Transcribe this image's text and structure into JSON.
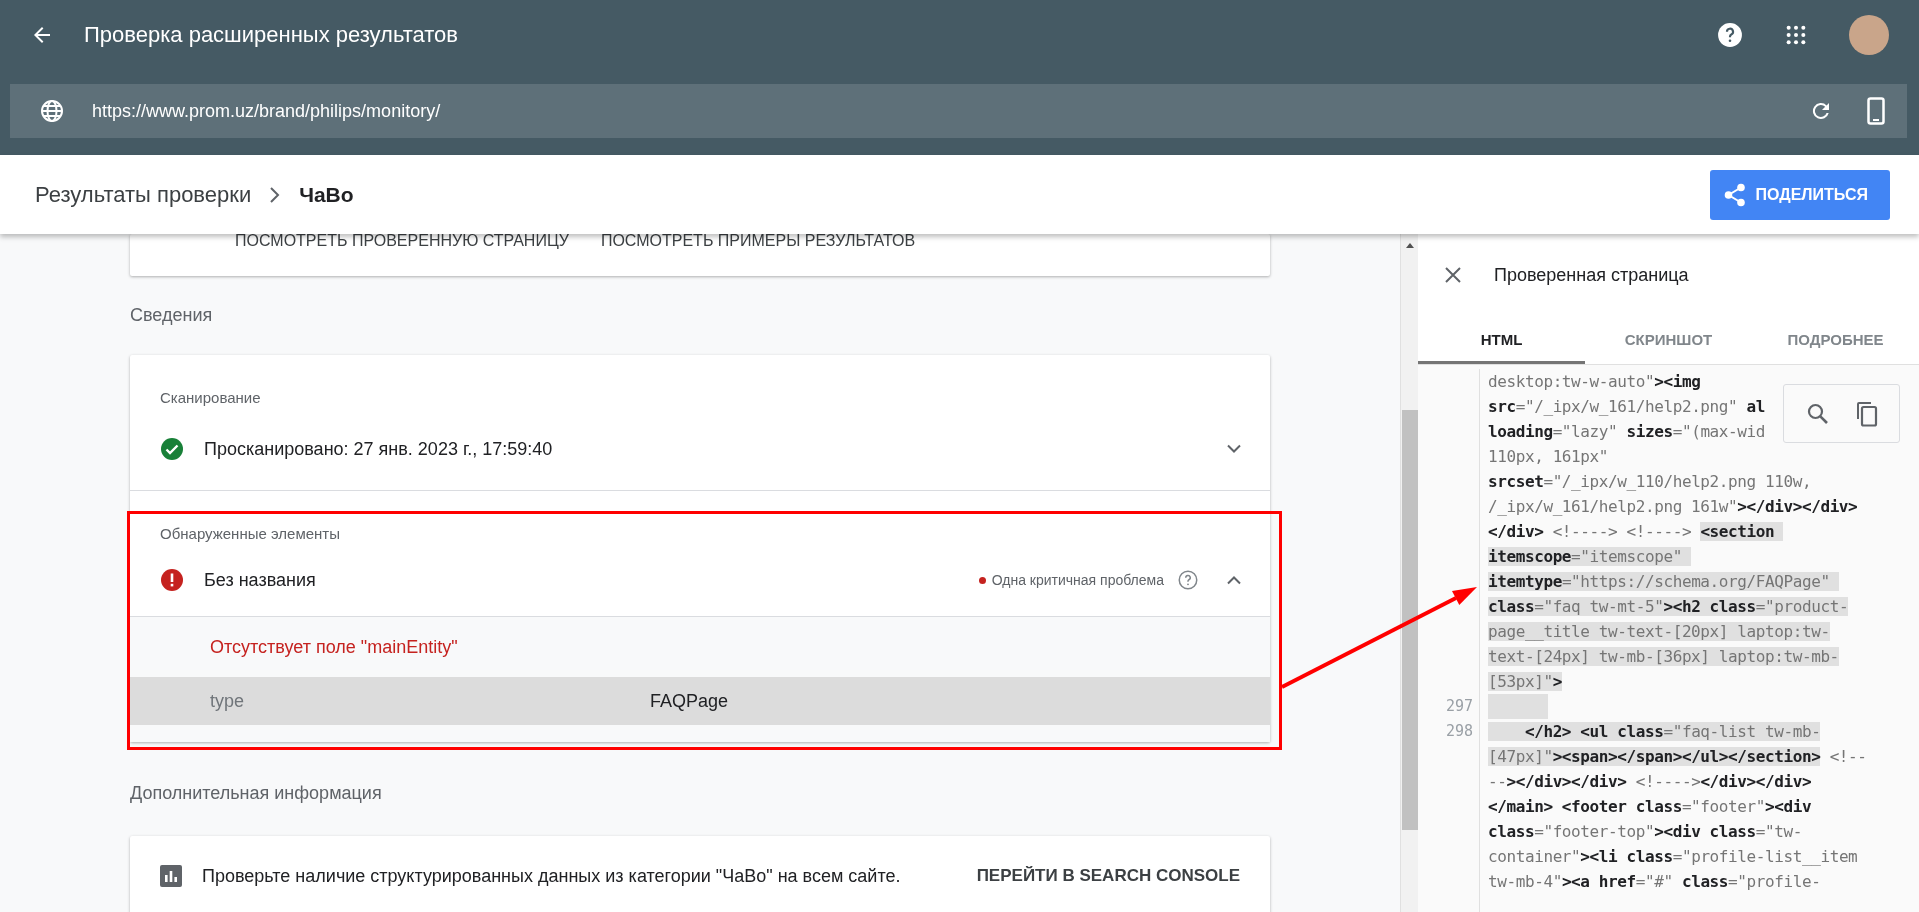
{
  "app_bar": {
    "title": "Проверка расширенных результатов"
  },
  "url_bar": {
    "value": "https://www.prom.uz/brand/philips/monitory/"
  },
  "breadcrumb": [
    {
      "label": "Результаты проверки"
    },
    {
      "label": "ЧаВо"
    }
  ],
  "share_button": "ПОДЕЛИТЬСЯ",
  "top_card": {
    "links": [
      "ПОСМОТРЕТЬ ПРОВЕРЕННУЮ СТРАНИЦУ",
      "ПОСМОТРЕТЬ ПРИМЕРЫ РЕЗУЛЬТАТОВ"
    ]
  },
  "details": {
    "heading": "Сведения",
    "sections": [
      {
        "label": "Сканирование",
        "highlighted": false,
        "items": [
          {
            "kind": "ok",
            "title": "Просканировано: 27 янв. 2023 г., 17:59:40",
            "expanded": false
          }
        ]
      },
      {
        "label": "Обнаруженные элементы",
        "highlighted": true,
        "items": [
          {
            "kind": "error",
            "title": "Без названия",
            "issue_count": "Одна критичная проблема",
            "expanded": true,
            "error": "Отсутствует поле \"mainEntity\"",
            "properties": [
              {
                "name": "type",
                "value": "FAQPage"
              }
            ]
          }
        ]
      }
    ]
  },
  "more_info": {
    "heading": "Дополнительная информация",
    "text": "Проверьте наличие структурированных данных из категории \"ЧаВо\" на всем сайте.",
    "link": "ПЕРЕЙТИ В SEARCH CONSOLE"
  },
  "panel": {
    "title": "Проверенная страница",
    "tabs": [
      {
        "label": "HTML",
        "selected": true
      },
      {
        "label": "СКРИНШОТ",
        "selected": false
      },
      {
        "label": "ПОДРОБНЕЕ",
        "selected": false
      }
    ],
    "code_lines": [
      {
        "segments": [
          {
            "text": "desktop:tw-w-auto\"**><img**",
            "highlighted": false
          }
        ]
      },
      {
        "segments": [
          {
            "text": "**src**=\"/_ipx/w_161/help2.png\" **al**",
            "highlighted": false
          }
        ]
      },
      {
        "segments": [
          {
            "text": "**loading**=\"lazy\" **sizes**=\"(max-wid",
            "highlighted": false
          }
        ]
      },
      {
        "segments": [
          {
            "text": "110px, 161px\"",
            "highlighted": false
          }
        ]
      },
      {
        "segments": [
          {
            "text": "**srcset**=\"/_ipx/w_110/help2.png 110w,",
            "highlighted": false
          }
        ]
      },
      {
        "segments": [
          {
            "text": "/_ipx/w_161/help2.png 161w\"**></div></div>**",
            "highlighted": false
          }
        ]
      },
      {
        "segments": [
          {
            "text": "**</div>** <!----> <!----> ",
            "highlighted": false
          },
          {
            "text": "**<section** ",
            "highlighted": true
          }
        ]
      },
      {
        "segments": [
          {
            "text": "**itemscope**=\"itemscope\" ",
            "highlighted": true
          }
        ]
      },
      {
        "segments": [
          {
            "text": "**itemtype**=\"https://schema.org/FAQPage\" ",
            "highlighted": true
          }
        ]
      },
      {
        "segments": [
          {
            "text": "**class**=\"faq tw-mt-5\"**><h2 class**=\"product-",
            "highlighted": true
          }
        ]
      },
      {
        "segments": [
          {
            "text": "page__title tw-text-[20px] laptop:tw-",
            "highlighted": true
          }
        ]
      },
      {
        "segments": [
          {
            "text": "text-[24px] tw-mb-[36px] laptop:tw-mb-",
            "highlighted": true
          }
        ]
      },
      {
        "segments": [
          {
            "text": "[53px]\"**>**",
            "highlighted": true
          }
        ]
      },
      {
        "number": "297",
        "highlighted": true
      },
      {
        "number": "298",
        "segments": [
          {
            "text": "    **</h2> <ul class**=\"faq-list tw-mb-",
            "highlighted": true
          }
        ]
      },
      {
        "segments": [
          {
            "text": "[47px]\"**><span></span></ul></section>**",
            "highlighted": true
          },
          {
            "text": " <!--",
            "highlighted": false
          }
        ]
      },
      {
        "segments": [
          {
            "text": "--**></div></div>** <!---->**</div></div>**",
            "highlighted": false
          }
        ]
      },
      {
        "segments": [
          {
            "text": "**</main> <footer class**=\"footer\"**><div**",
            "highlighted": false
          }
        ]
      },
      {
        "segments": [
          {
            "text": "**class**=\"footer-top\"**><div class**=\"tw-",
            "highlighted": false
          }
        ]
      },
      {
        "segments": [
          {
            "text": "container\"**><li class**=\"profile-list__item",
            "highlighted": false
          }
        ]
      },
      {
        "segments": [
          {
            "text": "tw-mb-4\"**><a href**=\"#\" **class**=\"profile-",
            "highlighted": false
          }
        ]
      }
    ]
  }
}
